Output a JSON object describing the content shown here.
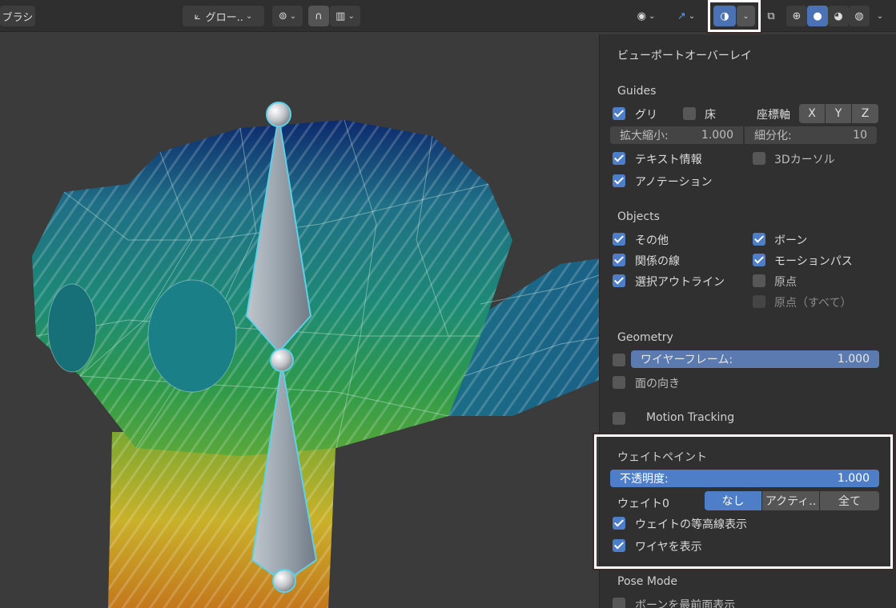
{
  "header": {
    "brush_label": "ブラシ",
    "transform_orientation": "グロー..",
    "colors": {
      "active": "#4b72b5"
    }
  },
  "panel": {
    "title": "ビューポートオーバーレイ",
    "guides": {
      "heading": "Guides",
      "grid_label": "グリ",
      "floor_label": "床",
      "axes_label": "座標軸",
      "axis_x": "X",
      "axis_y": "Y",
      "axis_z": "Z",
      "scale_label": "拡大縮小:",
      "scale_value": "1.000",
      "subdiv_label": "細分化:",
      "subdiv_value": "10",
      "text_info": "テキスト情報",
      "cursor_3d": "3Dカーソル",
      "annotations": "アノテーション"
    },
    "objects": {
      "heading": "Objects",
      "extras": "その他",
      "bones": "ボーン",
      "relationship_lines": "関係の線",
      "motion_paths": "モーションパス",
      "outline_selected": "選択アウトライン",
      "origins": "原点",
      "origins_all": "原点（すべて）"
    },
    "geometry": {
      "heading": "Geometry",
      "wireframe_label": "ワイヤーフレーム:",
      "wireframe_value": "1.000",
      "face_orientation": "面の向き"
    },
    "motion_tracking": "Motion Tracking",
    "weight_paint": {
      "heading": "ウェイトペイント",
      "opacity_label": "不透明度:",
      "opacity_value": "1.000",
      "zero_weights_label": "ウェイト0",
      "zero_none": "なし",
      "zero_active": "アクティ..",
      "zero_all": "全て",
      "show_contours": "ウェイトの等高線表示",
      "show_wire": "ワイヤを表示"
    },
    "pose_mode": {
      "heading": "Pose Mode",
      "bone_in_front": "ボーンを最前面表示"
    }
  }
}
